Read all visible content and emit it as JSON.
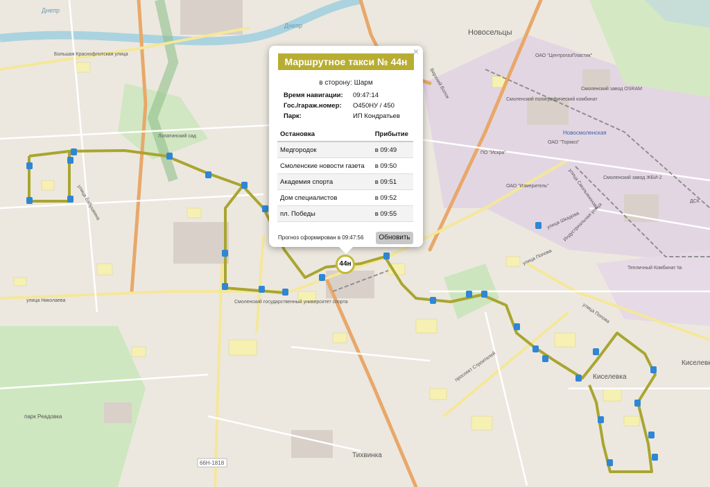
{
  "map": {
    "labels": {
      "novoseltsy": "Новосельцы",
      "dnepr1": "Днепр",
      "dnepr2": "Днепр",
      "bolshaya": "Большая Краснофлотская улица",
      "verkhniy_val": "Верхний Волок",
      "centrogaz": "ОАО \"ЦентрогазПластик\"",
      "poligraf": "Смоленский полиграфический комбинат",
      "osram": "Смоленский завод OSRAM",
      "novosmolenskaya": "Новосмоленская",
      "tormoz": "ОАО \"Тормоз\"",
      "iskra": "ПО \"Искра\"",
      "izmeritel": "ОАО \"Измеритель\"",
      "zhbi": "Смоленский завод ЖБИ-2",
      "dsk": "ДСК",
      "teplichny": "Тепличный Комбинат №",
      "lopatinsky": "Лопатинский сад",
      "nikolaeva": "улица Николаева",
      "babushkina": "улица Бабушкина",
      "smolgu": "Смоленский государственный университет спорта",
      "shkadova": "улица Шкадова",
      "popova": "улица Попова",
      "popova2": "улица Попова",
      "stroiteley": "проспект Строителей",
      "kiselevka1": "Киселевка",
      "kiselevka2": "Киселевка",
      "park": "парк Реадовка",
      "tikhvinka": "Тихвинка",
      "road": "66Н-1818",
      "industrialnaya": "Индустриальная улица",
      "smolyaninova": "улица Смольянинова"
    }
  },
  "popup": {
    "close": "×",
    "title": "Маршрутное такси № 44н",
    "direction": "в сторону: Шарм",
    "nav_label": "Время навигации:",
    "nav_value": "09:47:14",
    "plate_label": "Гос./гараж.номер:",
    "plate_value": "О450НУ / 450",
    "park_label": "Парк:",
    "park_value": "ИП Кондратьев",
    "col_stop": "Остановка",
    "col_arrival": "Прибытие",
    "rows": [
      {
        "stop": "Медгородок",
        "arrival": "в 09:49"
      },
      {
        "stop": "Смоленские новости газета",
        "arrival": "в 09:50"
      },
      {
        "stop": "Академия спорта",
        "arrival": "в 09:51"
      },
      {
        "stop": "Дом специалистов",
        "arrival": "в 09:52"
      },
      {
        "stop": "пл. Победы",
        "arrival": "в 09:55"
      }
    ],
    "forecast": "Прогноз сформирован в 09:47:56",
    "refresh": "Обновить"
  },
  "marker": {
    "label": "44н"
  },
  "colors": {
    "route": "#a9a530",
    "accent": "#b7ad32",
    "stop_icon": "#2f86d4"
  }
}
